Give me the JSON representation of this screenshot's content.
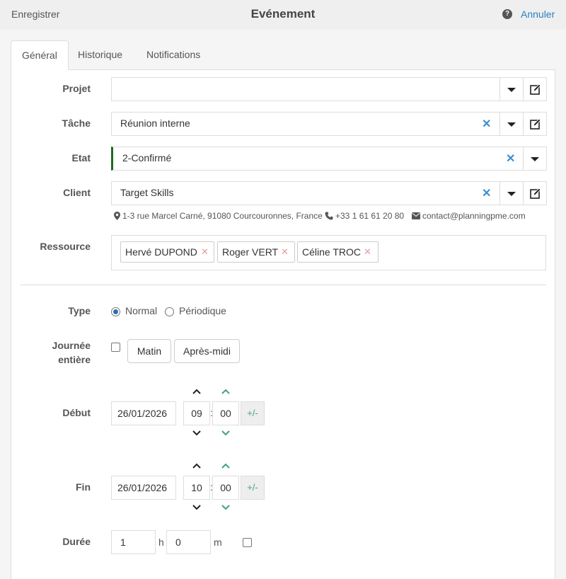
{
  "header": {
    "save_label": "Enregistrer",
    "title": "Evénement",
    "cancel_label": "Annuler",
    "help_icon": "question-circle-icon"
  },
  "tabs": [
    {
      "label": "Général",
      "active": true
    },
    {
      "label": "Historique",
      "active": false
    },
    {
      "label": "Notifications",
      "active": false
    }
  ],
  "form": {
    "projet": {
      "label": "Projet",
      "value": ""
    },
    "tache": {
      "label": "Tâche",
      "value": "Réunion interne"
    },
    "etat": {
      "label": "Etat",
      "value": "2-Confirmé",
      "accent_color": "#1e6b1e"
    },
    "client": {
      "label": "Client",
      "value": "Target Skills",
      "address": "1-3 rue Marcel Carné, 91080 Courcouronnes, France",
      "phone": "+33 1 61 61 20 80",
      "email": "contact@planningpme.com"
    },
    "ressource": {
      "label": "Ressource",
      "tags": [
        "Hervé DUPOND",
        "Roger VERT",
        "Céline TROC"
      ]
    },
    "type": {
      "label": "Type",
      "options": [
        "Normal",
        "Périodique"
      ],
      "selected": "Normal"
    },
    "journee": {
      "label_line1": "Journée",
      "label_line2": "entière",
      "checked": false,
      "matin_label": "Matin",
      "apresmidi_label": "Après-midi"
    },
    "debut": {
      "label": "Début",
      "date": "26/01/2026",
      "hour": "09",
      "minute": "00",
      "pm_label": "+/-"
    },
    "fin": {
      "label": "Fin",
      "date": "26/01/2026",
      "hour": "10",
      "minute": "00",
      "pm_label": "+/-"
    },
    "duree": {
      "label": "Durée",
      "hours": "1",
      "hours_unit": "h",
      "minutes": "0",
      "minutes_unit": "m",
      "checked": false
    }
  },
  "colors": {
    "link": "#2a7fc1",
    "clear_icon": "#3b8fd0",
    "chevron_minute": "#3aa57a",
    "tag_remove": "#e69a9a"
  }
}
